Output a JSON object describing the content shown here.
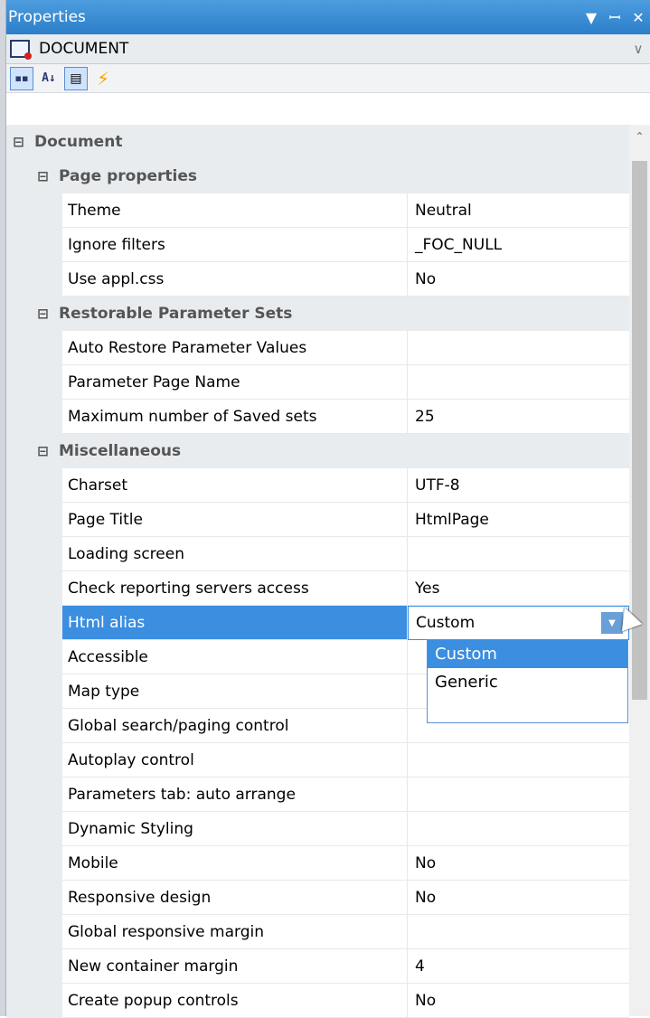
{
  "window": {
    "title": "Properties",
    "menu_icon": "▼",
    "pin_icon": "📌",
    "close_icon": "✕"
  },
  "object_selector": {
    "name": "DOCUMENT",
    "chevron": "∨"
  },
  "toolbar": {
    "categorized_glyph": "▪▪",
    "alphabetical_glyph": "A↓",
    "properties_glyph": "▤",
    "events_glyph": "⚡"
  },
  "categories": {
    "document": "Document",
    "page_properties": "Page properties",
    "restorable": "Restorable Parameter Sets",
    "misc": "Miscellaneous"
  },
  "rows": [
    {
      "name": "Theme",
      "value": "Neutral"
    },
    {
      "name": "Ignore filters",
      "value": "_FOC_NULL"
    },
    {
      "name": "Use appl.css",
      "value": "No"
    },
    {
      "name": "Auto Restore Parameter Values",
      "value": ""
    },
    {
      "name": "Parameter Page Name",
      "value": ""
    },
    {
      "name": "Maximum number of Saved sets",
      "value": "25"
    },
    {
      "name": "Charset",
      "value": "UTF-8"
    },
    {
      "name": "Page Title",
      "value": "HtmlPage"
    },
    {
      "name": "Loading screen",
      "value": ""
    },
    {
      "name": "Check reporting servers access",
      "value": "Yes"
    },
    {
      "name": "Html alias",
      "value": "Custom"
    },
    {
      "name": "Accessible",
      "value": ""
    },
    {
      "name": "Map type",
      "value": ""
    },
    {
      "name": "Global search/paging control",
      "value": ""
    },
    {
      "name": "Autoplay control",
      "value": ""
    },
    {
      "name": "Parameters tab: auto arrange",
      "value": ""
    },
    {
      "name": "Dynamic Styling",
      "value": ""
    },
    {
      "name": "Mobile",
      "value": "No"
    },
    {
      "name": "Responsive design",
      "value": "No"
    },
    {
      "name": "Global responsive margin",
      "value": ""
    },
    {
      "name": "New container margin",
      "value": "4"
    },
    {
      "name": "Create popup controls",
      "value": "No"
    }
  ],
  "dropdown": {
    "options": [
      "Custom",
      "Generic"
    ],
    "selected": "Custom"
  },
  "toggle_glyph": "⊟",
  "scroll_up_glyph": "⌃",
  "dd_arrow_glyph": "▼"
}
